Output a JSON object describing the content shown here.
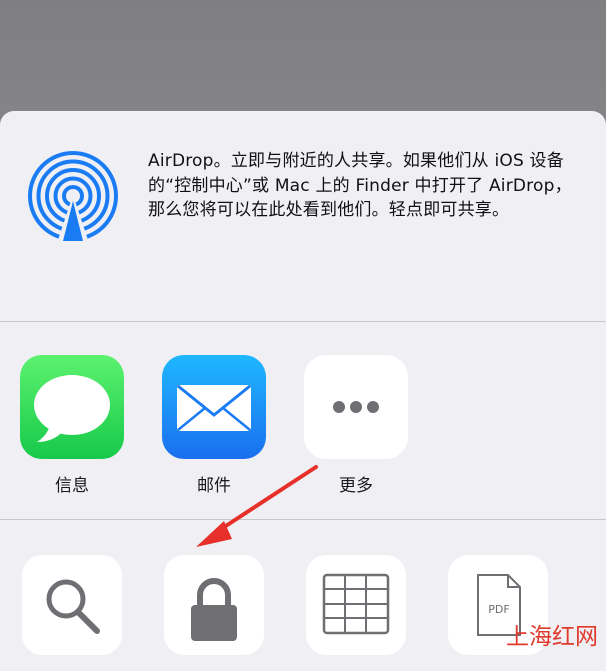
{
  "airdrop": {
    "description": "AirDrop。立即与附近的人共享。如果他们从 iOS 设备的“控制中心”或 Mac 上的 Finder 中打开了 AirDrop，那么您将可以在此处看到他们。轻点即可共享。",
    "icon": "airdrop-icon"
  },
  "apps": [
    {
      "label": "信息",
      "icon": "messages-bubble-icon",
      "color": "#2ed158"
    },
    {
      "label": "邮件",
      "icon": "mail-envelope-icon",
      "color": "#1e8cf8"
    },
    {
      "label": "更多",
      "icon": "more-dots-icon",
      "color": "#ffffff"
    }
  ],
  "actions": [
    {
      "icon": "search-icon"
    },
    {
      "icon": "lock-icon"
    },
    {
      "icon": "grid-table-icon"
    },
    {
      "icon": "pdf-document-icon",
      "text": "PDF"
    }
  ],
  "watermark": "上海红网",
  "colors": {
    "sheet_background": "#efeff4",
    "airdrop_blue": "#1a7cf5",
    "annotation_arrow": "#e8302a",
    "icon_gray": "#6e6e73"
  }
}
